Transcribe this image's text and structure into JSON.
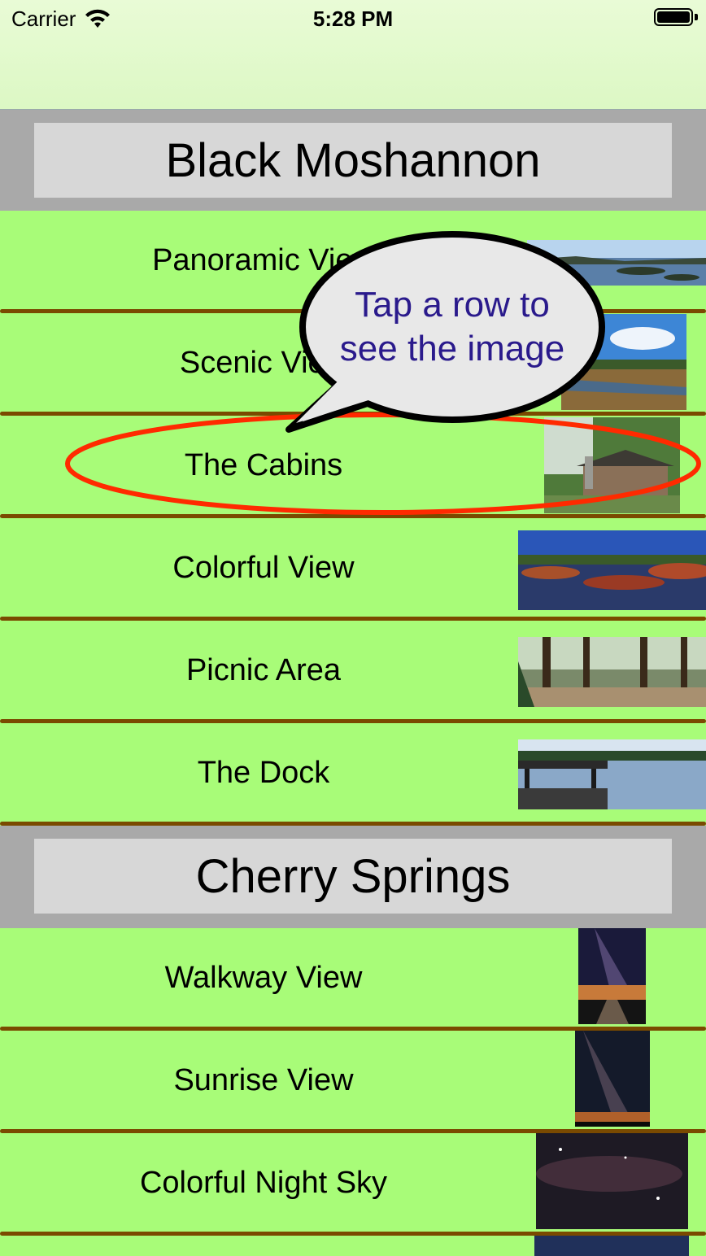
{
  "status": {
    "carrier": "Carrier",
    "time": "5:28 PM"
  },
  "sections": [
    {
      "title": "Black Moshannon",
      "rows": [
        "Panoramic View",
        "Scenic View",
        "The Cabins",
        "Colorful View",
        "Picnic Area",
        "The Dock"
      ]
    },
    {
      "title": "Cherry Springs",
      "rows": [
        "Walkway View",
        "Sunrise View",
        "Colorful Night Sky"
      ]
    }
  ],
  "callout": {
    "line1": "Tap a row to",
    "line2": "see the image"
  },
  "colors": {
    "row_bg": "#a8fc78",
    "separator": "#7a4a00",
    "section_bg": "#a9a9a9",
    "header_bg": "#d7d7d7",
    "highlight": "#ff2a00",
    "callout_text": "#2a1a8c"
  }
}
